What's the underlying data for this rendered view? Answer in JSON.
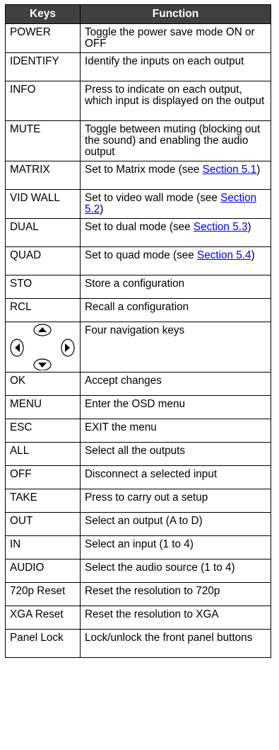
{
  "table": {
    "header_keys": "Keys",
    "header_function": "Function",
    "rows": [
      {
        "key": "POWER",
        "function": "Toggle the power save mode ON or OFF"
      },
      {
        "key": "IDENTIFY",
        "function": "Identify the inputs on each output"
      },
      {
        "key": "INFO",
        "function": "Press to indicate on each output, which input is displayed on the output"
      },
      {
        "key": "MUTE",
        "function": "Toggle between muting (blocking out the sound) and enabling the audio output"
      },
      {
        "key": "MATRIX",
        "function": "Set to Matrix mode (see ",
        "link": "Section 5.1",
        "suffix": ")"
      },
      {
        "key": "VID WALL",
        "function": "Set to video wall mode (see ",
        "link": "Section 5.2",
        "suffix": ")"
      },
      {
        "key": "DUAL",
        "function": "Set to dual mode (see ",
        "link": "Section 5.3",
        "suffix": ")"
      },
      {
        "key": "QUAD",
        "function": "Set to quad mode (see ",
        "link": "Section 5.4",
        "suffix": ")"
      },
      {
        "key": "STO",
        "function": "Store a configuration"
      },
      {
        "key": "RCL",
        "function": "Recall a configuration"
      },
      {
        "key": "",
        "function": "Four navigation keys"
      },
      {
        "key": "OK",
        "function": "Accept changes"
      },
      {
        "key": "MENU",
        "function": "Enter the OSD menu"
      },
      {
        "key": "ESC",
        "function": "EXIT the menu"
      },
      {
        "key": "ALL",
        "function": "Select all the outputs"
      },
      {
        "key": "OFF",
        "function": "Disconnect a selected input"
      },
      {
        "key": "TAKE",
        "function": "Press to carry out a setup"
      },
      {
        "key": "OUT",
        "function": "Select an output (A to D)"
      },
      {
        "key": "IN",
        "function": "Select an input (1 to 4)"
      },
      {
        "key": "AUDIO",
        "function": "Select the audio source (1 to 4)"
      },
      {
        "key": "720p Reset",
        "function": "Reset the resolution to 720p"
      },
      {
        "key": "XGA Reset",
        "function": "Reset the resolution to XGA"
      },
      {
        "key": "Panel Lock",
        "function": "Lock/unlock the front panel buttons"
      }
    ],
    "nav_icons": [
      "arrow-up-icon",
      "arrow-left-icon",
      "arrow-right-icon",
      "arrow-down-icon"
    ]
  },
  "colors": {
    "header_bg": "#404040",
    "header_text": "#ffffff",
    "link": "#0000ee",
    "border": "#000000"
  }
}
